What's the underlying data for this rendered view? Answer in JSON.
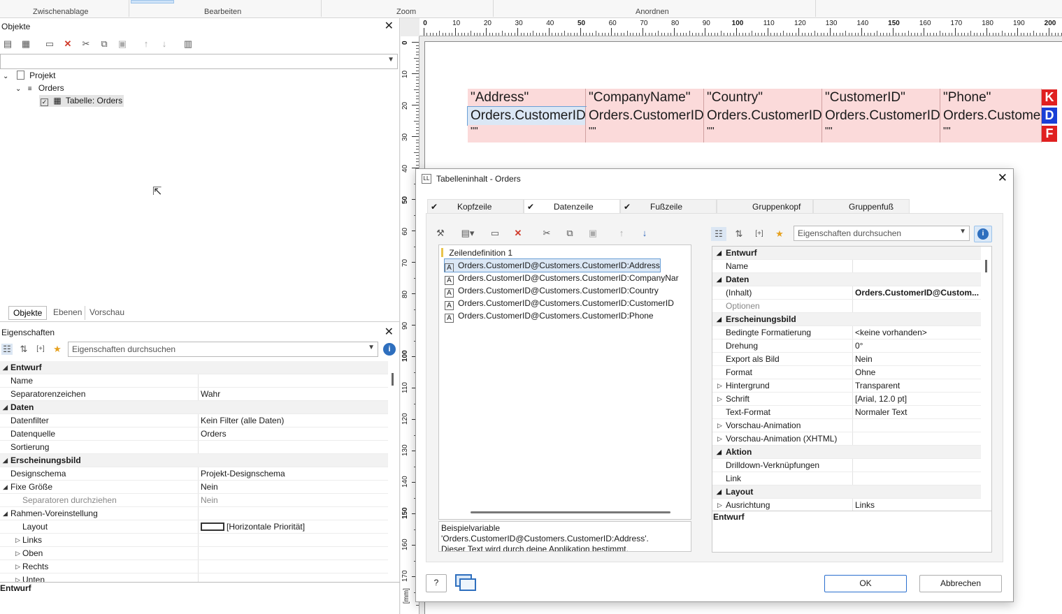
{
  "ribbon": {
    "groups": [
      "Zwischenablage",
      "Bearbeiten",
      "Zoom",
      "Anordnen"
    ]
  },
  "objects_panel": {
    "title": "Objekte",
    "close": "✕",
    "tree": {
      "project": "Projekt",
      "orders": "Orders",
      "table": "Tabelle: Orders"
    },
    "tabs": [
      "Objekte",
      "Ebenen",
      "Vorschau"
    ]
  },
  "properties_panel": {
    "title": "Eigenschaften",
    "search_placeholder": "Eigenschaften durchsuchen",
    "rows": [
      {
        "k": "Entwurf",
        "v": "",
        "type": "cat"
      },
      {
        "k": "Name",
        "v": "",
        "type": ""
      },
      {
        "k": "Separatorenzeichen",
        "v": "Wahr",
        "type": ""
      },
      {
        "k": "Daten",
        "v": "",
        "type": "cat"
      },
      {
        "k": "Datenfilter",
        "v": "Kein Filter (alle Daten)",
        "type": ""
      },
      {
        "k": "Datenquelle",
        "v": "Orders",
        "type": ""
      },
      {
        "k": "Sortierung",
        "v": "",
        "type": ""
      },
      {
        "k": "Erscheinungsbild",
        "v": "",
        "type": "cat"
      },
      {
        "k": "Designschema",
        "v": "Projekt-Designschema",
        "type": ""
      },
      {
        "k": "Fixe Größe",
        "v": "Nein",
        "type": "exp"
      },
      {
        "k": "Separatoren durchziehen",
        "v": "Nein",
        "type": "sub"
      },
      {
        "k": "Rahmen-Voreinstellung",
        "v": "",
        "type": "exp"
      },
      {
        "k": "Layout",
        "v": "[Horizontale Priorität]",
        "type": "sub"
      },
      {
        "k": "Links",
        "v": "",
        "type": "col"
      },
      {
        "k": "Oben",
        "v": "",
        "type": "col"
      },
      {
        "k": "Rechts",
        "v": "",
        "type": "col"
      },
      {
        "k": "Unten",
        "v": "",
        "type": "col"
      }
    ],
    "footer": "Entwurf"
  },
  "ruler": {
    "top": [
      "0",
      "10",
      "20",
      "30",
      "40",
      "50",
      "60",
      "70",
      "80",
      "90",
      "100",
      "110",
      "120",
      "130",
      "140",
      "150",
      "160",
      "170",
      "180",
      "190",
      "200"
    ],
    "left": [
      "0",
      "10",
      "20",
      "30",
      "40",
      "50",
      "60",
      "70",
      "80",
      "90",
      "100",
      "110",
      "120",
      "130",
      "140",
      "150",
      "160",
      "170"
    ],
    "unit": "[mm]"
  },
  "table": {
    "headers": [
      "\"Address\"",
      "\"CompanyName\"",
      "\"Country\"",
      "\"CustomerID\"",
      "\"Phone\""
    ],
    "data": [
      "Orders.CustomerID@",
      "Orders.CustomerID@",
      "Orders.CustomerID@",
      "Orders.CustomerID@",
      "Orders.CustomerID"
    ],
    "footer": [
      "\"\"",
      "\"\"",
      "\"\"",
      "\"\"",
      "\"\""
    ],
    "marks": [
      "K",
      "D",
      "F"
    ]
  },
  "dialog": {
    "title": "Tabelleninhalt - Orders",
    "tabs": [
      {
        "label": "Kopfzeile",
        "checked": "✔"
      },
      {
        "label": "Datenzeile",
        "checked": "✔"
      },
      {
        "label": "Fußzeile",
        "checked": "✔"
      },
      {
        "label": "Gruppenkopf",
        "checked": ""
      },
      {
        "label": "Gruppenfuß",
        "checked": ""
      }
    ],
    "row_def": "Zeilendefinition  1",
    "fields": [
      "Orders.CustomerID@Customers.CustomerID:Address",
      "Orders.CustomerID@Customers.CustomerID:CompanyNar",
      "Orders.CustomerID@Customers.CustomerID:Country",
      "Orders.CustomerID@Customers.CustomerID:CustomerID",
      "Orders.CustomerID@Customers.CustomerID:Phone"
    ],
    "description": [
      "Beispielvariable",
      "'Orders.CustomerID@Customers.CustomerID:Address'.",
      "Dieser Text wird durch deine Applikation bestimmt."
    ],
    "search_placeholder": "Eigenschaften durchsuchen",
    "props": [
      {
        "k": "Entwurf",
        "v": "",
        "type": "cat"
      },
      {
        "k": "Name",
        "v": "",
        "type": ""
      },
      {
        "k": "Daten",
        "v": "",
        "type": "cat"
      },
      {
        "k": "(Inhalt)",
        "v": "Orders.CustomerID@Custom...",
        "type": "bold"
      },
      {
        "k": "Optionen",
        "v": "",
        "type": "dis"
      },
      {
        "k": "Erscheinungsbild",
        "v": "",
        "type": "cat"
      },
      {
        "k": "Bedingte Formatierung",
        "v": "<keine vorhanden>",
        "type": ""
      },
      {
        "k": "Drehung",
        "v": "0°",
        "type": ""
      },
      {
        "k": "Export als Bild",
        "v": "Nein",
        "type": ""
      },
      {
        "k": "Format",
        "v": "Ohne",
        "type": ""
      },
      {
        "k": "Hintergrund",
        "v": "Transparent",
        "type": "col"
      },
      {
        "k": "Schrift",
        "v": "[Arial, 12.0 pt]",
        "type": "col"
      },
      {
        "k": "Text-Format",
        "v": "Normaler Text",
        "type": ""
      },
      {
        "k": "Vorschau-Animation",
        "v": "",
        "type": "col"
      },
      {
        "k": "Vorschau-Animation (XHTML)",
        "v": "",
        "type": "col"
      },
      {
        "k": "Aktion",
        "v": "",
        "type": "cat"
      },
      {
        "k": "Drilldown-Verknüpfungen",
        "v": "",
        "type": ""
      },
      {
        "k": "Link",
        "v": "",
        "type": ""
      },
      {
        "k": "Layout",
        "v": "",
        "type": "cat"
      },
      {
        "k": "Ausrichtung",
        "v": "Links",
        "type": "col"
      }
    ],
    "props_footer": "Entwurf",
    "ok": "OK",
    "cancel": "Abbrechen"
  }
}
